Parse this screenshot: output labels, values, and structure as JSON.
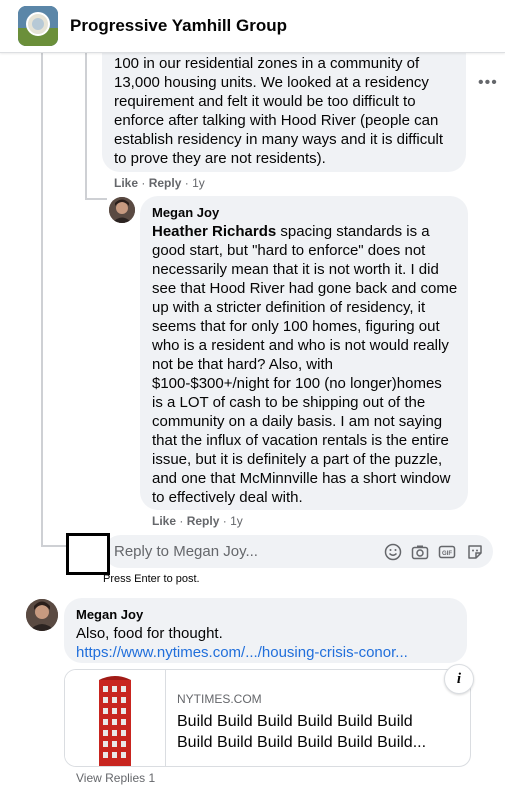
{
  "header": {
    "group_name": "Progressive Yamhill Group"
  },
  "comment1": {
    "lines": [
      "100 in our residential zones in a community of",
      "13,000 housing units. We looked at a residency",
      "requirement and felt it would be too difficult to",
      "enforce after talking with Hood River (people can",
      "establish residency in many ways and it is difficult",
      "to prove they are not residents)."
    ],
    "like": "Like",
    "sep": "·",
    "reply": "Reply",
    "time": "1y"
  },
  "comment2": {
    "author": "Megan Joy",
    "mention": "Heather Richards",
    "first_line_rest": " spacing standards is a",
    "lines": [
      "good start, but \"hard to enforce\" does not",
      "necessarily mean that it is not worth it. I did",
      "see that Hood River had gone back and come",
      "up with a stricter definition of residency, it",
      "seems that for only 100 homes, figuring out",
      "who is a resident and who is not would really",
      "not be that hard? Also, with",
      "$100-$300+/night for 100 (no longer)homes",
      "is a LOT of cash to be shipping out of the",
      "community on a daily basis. I am not saying",
      "that the influx of vacation rentals is the entire",
      "issue, but it is definitely a part of the puzzle,",
      "and one that McMinnville has a short window",
      "to effectively deal with."
    ],
    "like": "Like",
    "sep": "·",
    "reply": "Reply",
    "time": "1y"
  },
  "reply_input": {
    "placeholder": "Reply to Megan Joy...",
    "hint": "Press Enter to post."
  },
  "comment3": {
    "author": "Megan Joy",
    "text": "Also, food for thought.",
    "link": "https://www.nytimes.com/.../housing-crisis-conor..."
  },
  "link_card": {
    "source": "NYTIMES.COM",
    "title_line1": "Build Build Build Build Build Build",
    "title_line2": "Build Build Build Build Build Build..."
  },
  "cut_text": "View Replies 1",
  "colors": {
    "bubble": "#f0f2f5",
    "link": "#216fdb",
    "meta": "#65676b"
  }
}
